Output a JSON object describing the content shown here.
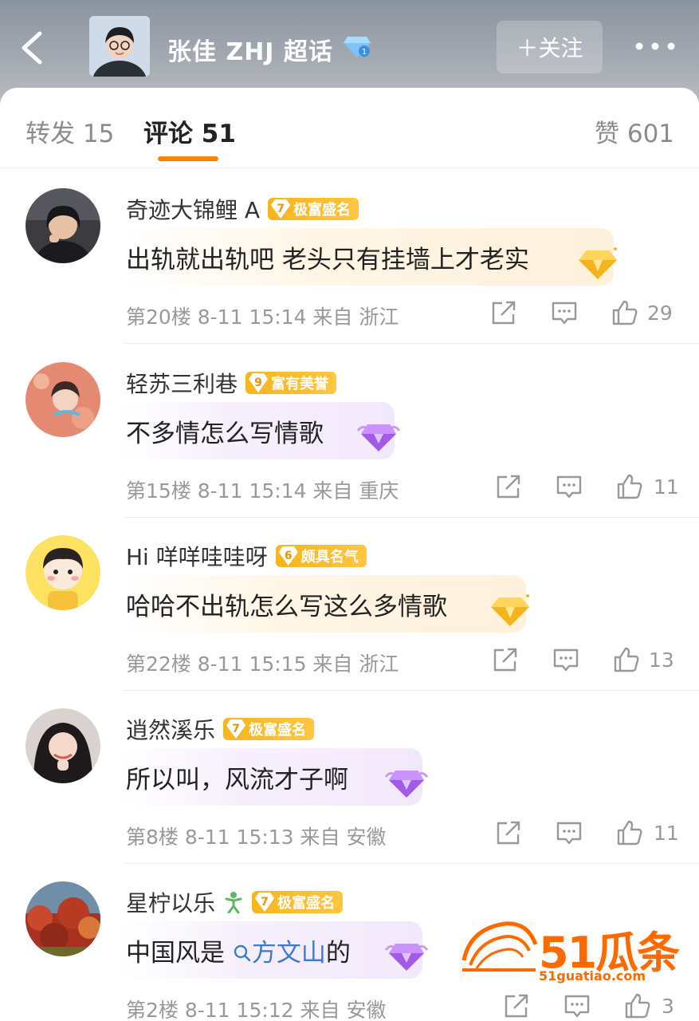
{
  "header": {
    "title": "张佳 ZHJ 超话",
    "follow_label": "＋关注"
  },
  "tabs": {
    "repost": "转发 15",
    "comments": "评论 51",
    "likes": "赞 601"
  },
  "comments": [
    {
      "username": "奇迹大锦鲤 A",
      "level": "7",
      "badge": "极富盛名",
      "text": "出轨就出轨吧 老头只有挂墙上才老实",
      "meta": "第20楼  8-11 15:14  来自 浙江",
      "likes": "29",
      "gem": "gold"
    },
    {
      "username": "轻苏三利巷",
      "level": "9",
      "badge": "富有美誉",
      "text": "不多情怎么写情歌",
      "meta": "第15楼  8-11 15:14  来自 重庆",
      "likes": "11",
      "gem": "purple"
    },
    {
      "username": "Hi 咩咩哇哇呀",
      "level": "6",
      "badge": "颇具名气",
      "text": "哈哈不出轨怎么写这么多情歌",
      "meta": "第22楼  8-11 15:15  来自 浙江",
      "likes": "13",
      "gem": "gold"
    },
    {
      "username": "逍然溪乐",
      "level": "7",
      "badge": "极富盛名",
      "text": "所以叫，风流才子啊",
      "meta": "第8楼  8-11 15:13  来自 安徽",
      "likes": "11",
      "gem": "purple"
    },
    {
      "username": "星柠以乐",
      "level": "7",
      "badge": "极富盛名",
      "text_before": "中国风是 ",
      "text_link": "方文山",
      "text_after": "的",
      "meta": "第2楼  8-11 15:12  来自 安徽",
      "likes": "3",
      "gem": "purple"
    }
  ],
  "watermark": {
    "brand": "51瓜条",
    "url": "51guatiao.com"
  }
}
